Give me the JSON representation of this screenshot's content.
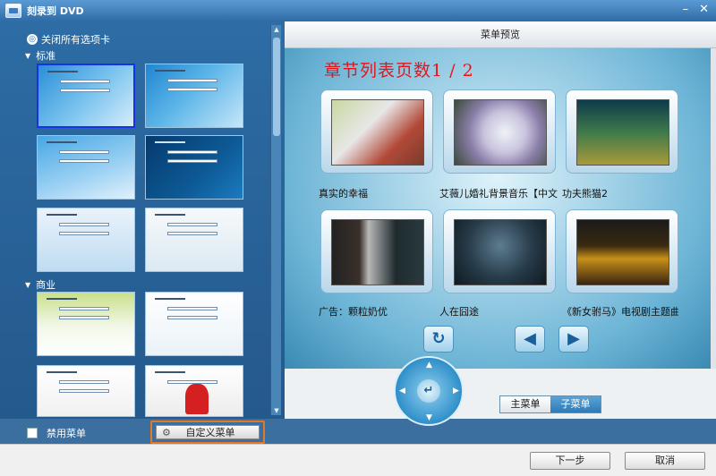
{
  "window": {
    "title": "刻录到 DVD",
    "minimize": "–",
    "close": "✕"
  },
  "left": {
    "close_all_label": "关闭所有选项卡",
    "groups": [
      {
        "label": "标准"
      },
      {
        "label": "商业"
      }
    ],
    "disable_menu_label": "禁用菜单",
    "custom_menu_label": "自定义菜单"
  },
  "preview": {
    "header": "菜单预览",
    "page_title": "章节列表页数1 / 2",
    "chapters": [
      {
        "caption": "真实的幸福"
      },
      {
        "caption": "艾薇儿婚礼背景音乐【中文"
      },
      {
        "caption": "功夫熊猫2"
      },
      {
        "caption": "广告：颗粒奶优"
      },
      {
        "caption": "人在囧途"
      },
      {
        "caption": "《新女驸马》电视剧主题曲"
      }
    ]
  },
  "controls": {
    "main_menu_tab": "主菜单",
    "sub_menu_tab": "子菜单"
  },
  "footer": {
    "next_label": "下一步",
    "cancel_label": "取消"
  },
  "icons": {
    "back": "return-icon",
    "prev": "arrow-left-icon",
    "next": "arrow-right-icon",
    "gear": "gear-icon"
  }
}
